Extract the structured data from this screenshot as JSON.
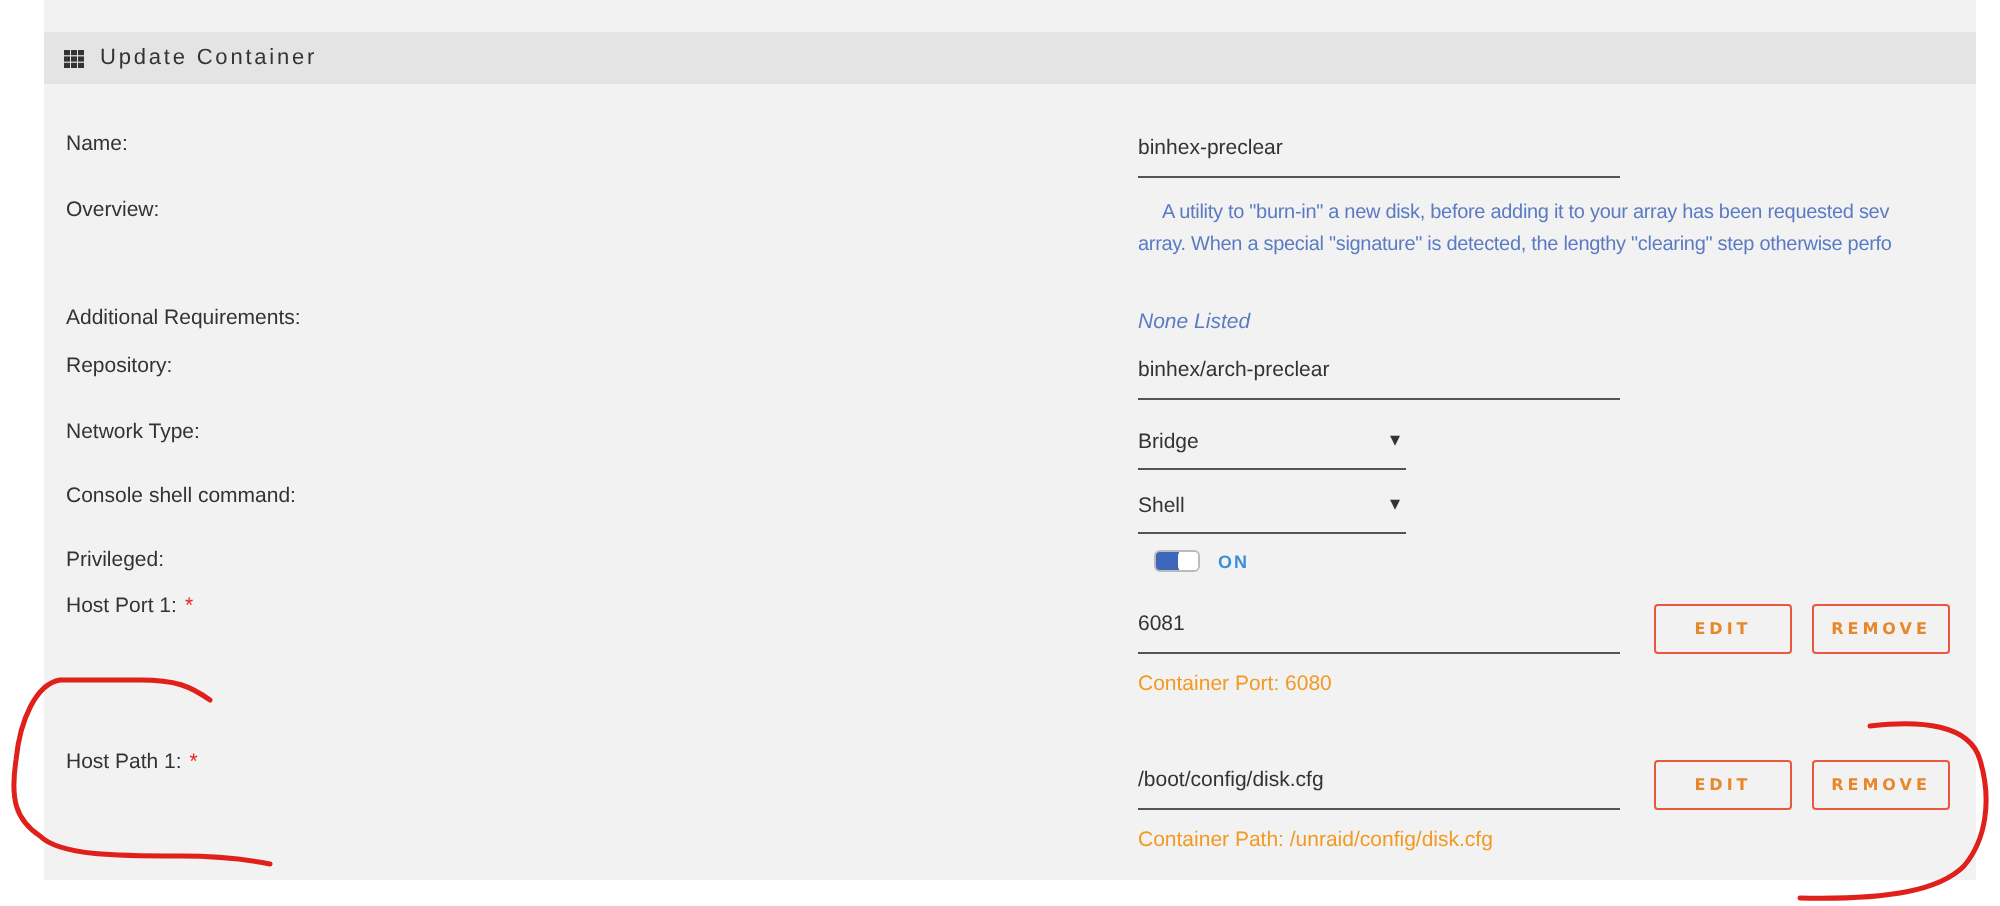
{
  "panel": {
    "title": "Update Container"
  },
  "fields": [
    {
      "label": "Name:",
      "required": false,
      "kind": "input",
      "value": "binhex-preclear"
    },
    {
      "label": "Overview:",
      "required": false,
      "kind": "description",
      "lines": [
        "A utility to \"burn-in\" a new disk, before adding it to your array has been requested sev",
        "array. When a special \"signature\" is detected, the lengthy \"clearing\" step otherwise perfo"
      ]
    },
    {
      "label": "Additional Requirements:",
      "required": false,
      "kind": "note",
      "value": "None Listed"
    },
    {
      "label": "Repository:",
      "required": false,
      "kind": "input",
      "value": "binhex/arch-preclear"
    },
    {
      "label": "Network Type:",
      "required": false,
      "kind": "select",
      "value": "Bridge",
      "caret": "▾"
    },
    {
      "label": "Console shell command:",
      "required": false,
      "kind": "select",
      "value": "Shell",
      "caret": "▾"
    },
    {
      "label": "Privileged:",
      "required": false,
      "kind": "toggle",
      "on": true,
      "state_label": "ON"
    },
    {
      "label": "Host Port 1:",
      "required": true,
      "kind": "mapping",
      "value": "6081",
      "buttons": [
        "EDIT",
        "REMOVE"
      ],
      "hint": "Container Port: 6080"
    },
    {
      "label": "Host Path 1:",
      "required": true,
      "kind": "mapping",
      "value": "/boot/config/disk.cfg",
      "buttons": [
        "EDIT",
        "REMOVE"
      ],
      "hint": "Container Path: /unraid/config/disk.cfg"
    }
  ],
  "required_mark": "*"
}
